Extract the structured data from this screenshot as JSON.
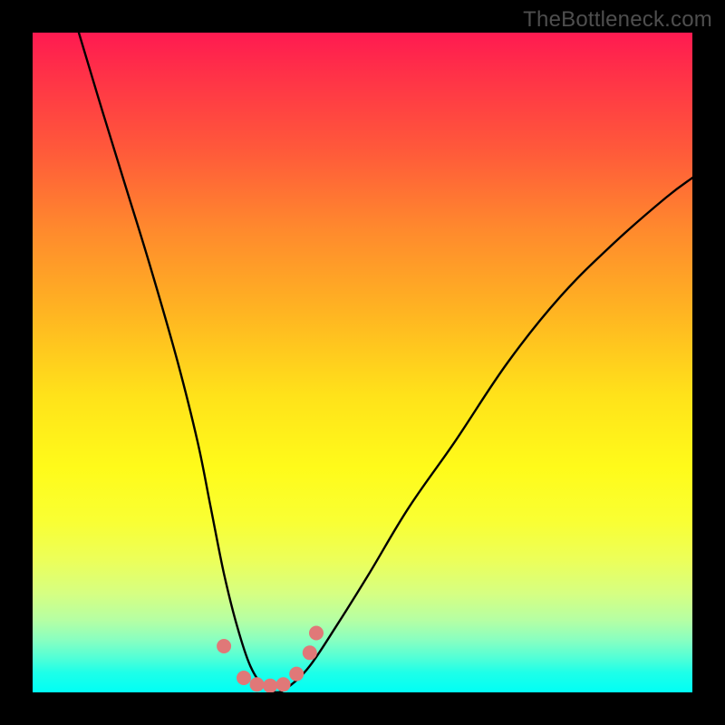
{
  "watermark": "TheBottleneck.com",
  "chart_data": {
    "type": "line",
    "title": "",
    "xlabel": "",
    "ylabel": "",
    "xlim": [
      0,
      100
    ],
    "ylim": [
      0,
      100
    ],
    "series": [
      {
        "name": "bottleneck-curve",
        "x": [
          7,
          10,
          14,
          18,
          22,
          25,
          27,
          29,
          31,
          33,
          35,
          37,
          39,
          42,
          46,
          51,
          57,
          64,
          72,
          80,
          88,
          96,
          100
        ],
        "values": [
          100,
          90,
          77,
          64,
          50,
          38,
          28,
          18,
          10,
          4,
          1,
          0,
          1,
          4,
          10,
          18,
          28,
          38,
          50,
          60,
          68,
          75,
          78
        ]
      }
    ],
    "markers": {
      "name": "highlight-dots",
      "color": "#e07878",
      "x": [
        29,
        32,
        34,
        36,
        38,
        40,
        42,
        43
      ],
      "values": [
        7,
        2.2,
        1.2,
        1,
        1.2,
        2.8,
        6,
        9
      ]
    }
  },
  "colors": {
    "curve": "#000000",
    "marker": "#e07878"
  }
}
